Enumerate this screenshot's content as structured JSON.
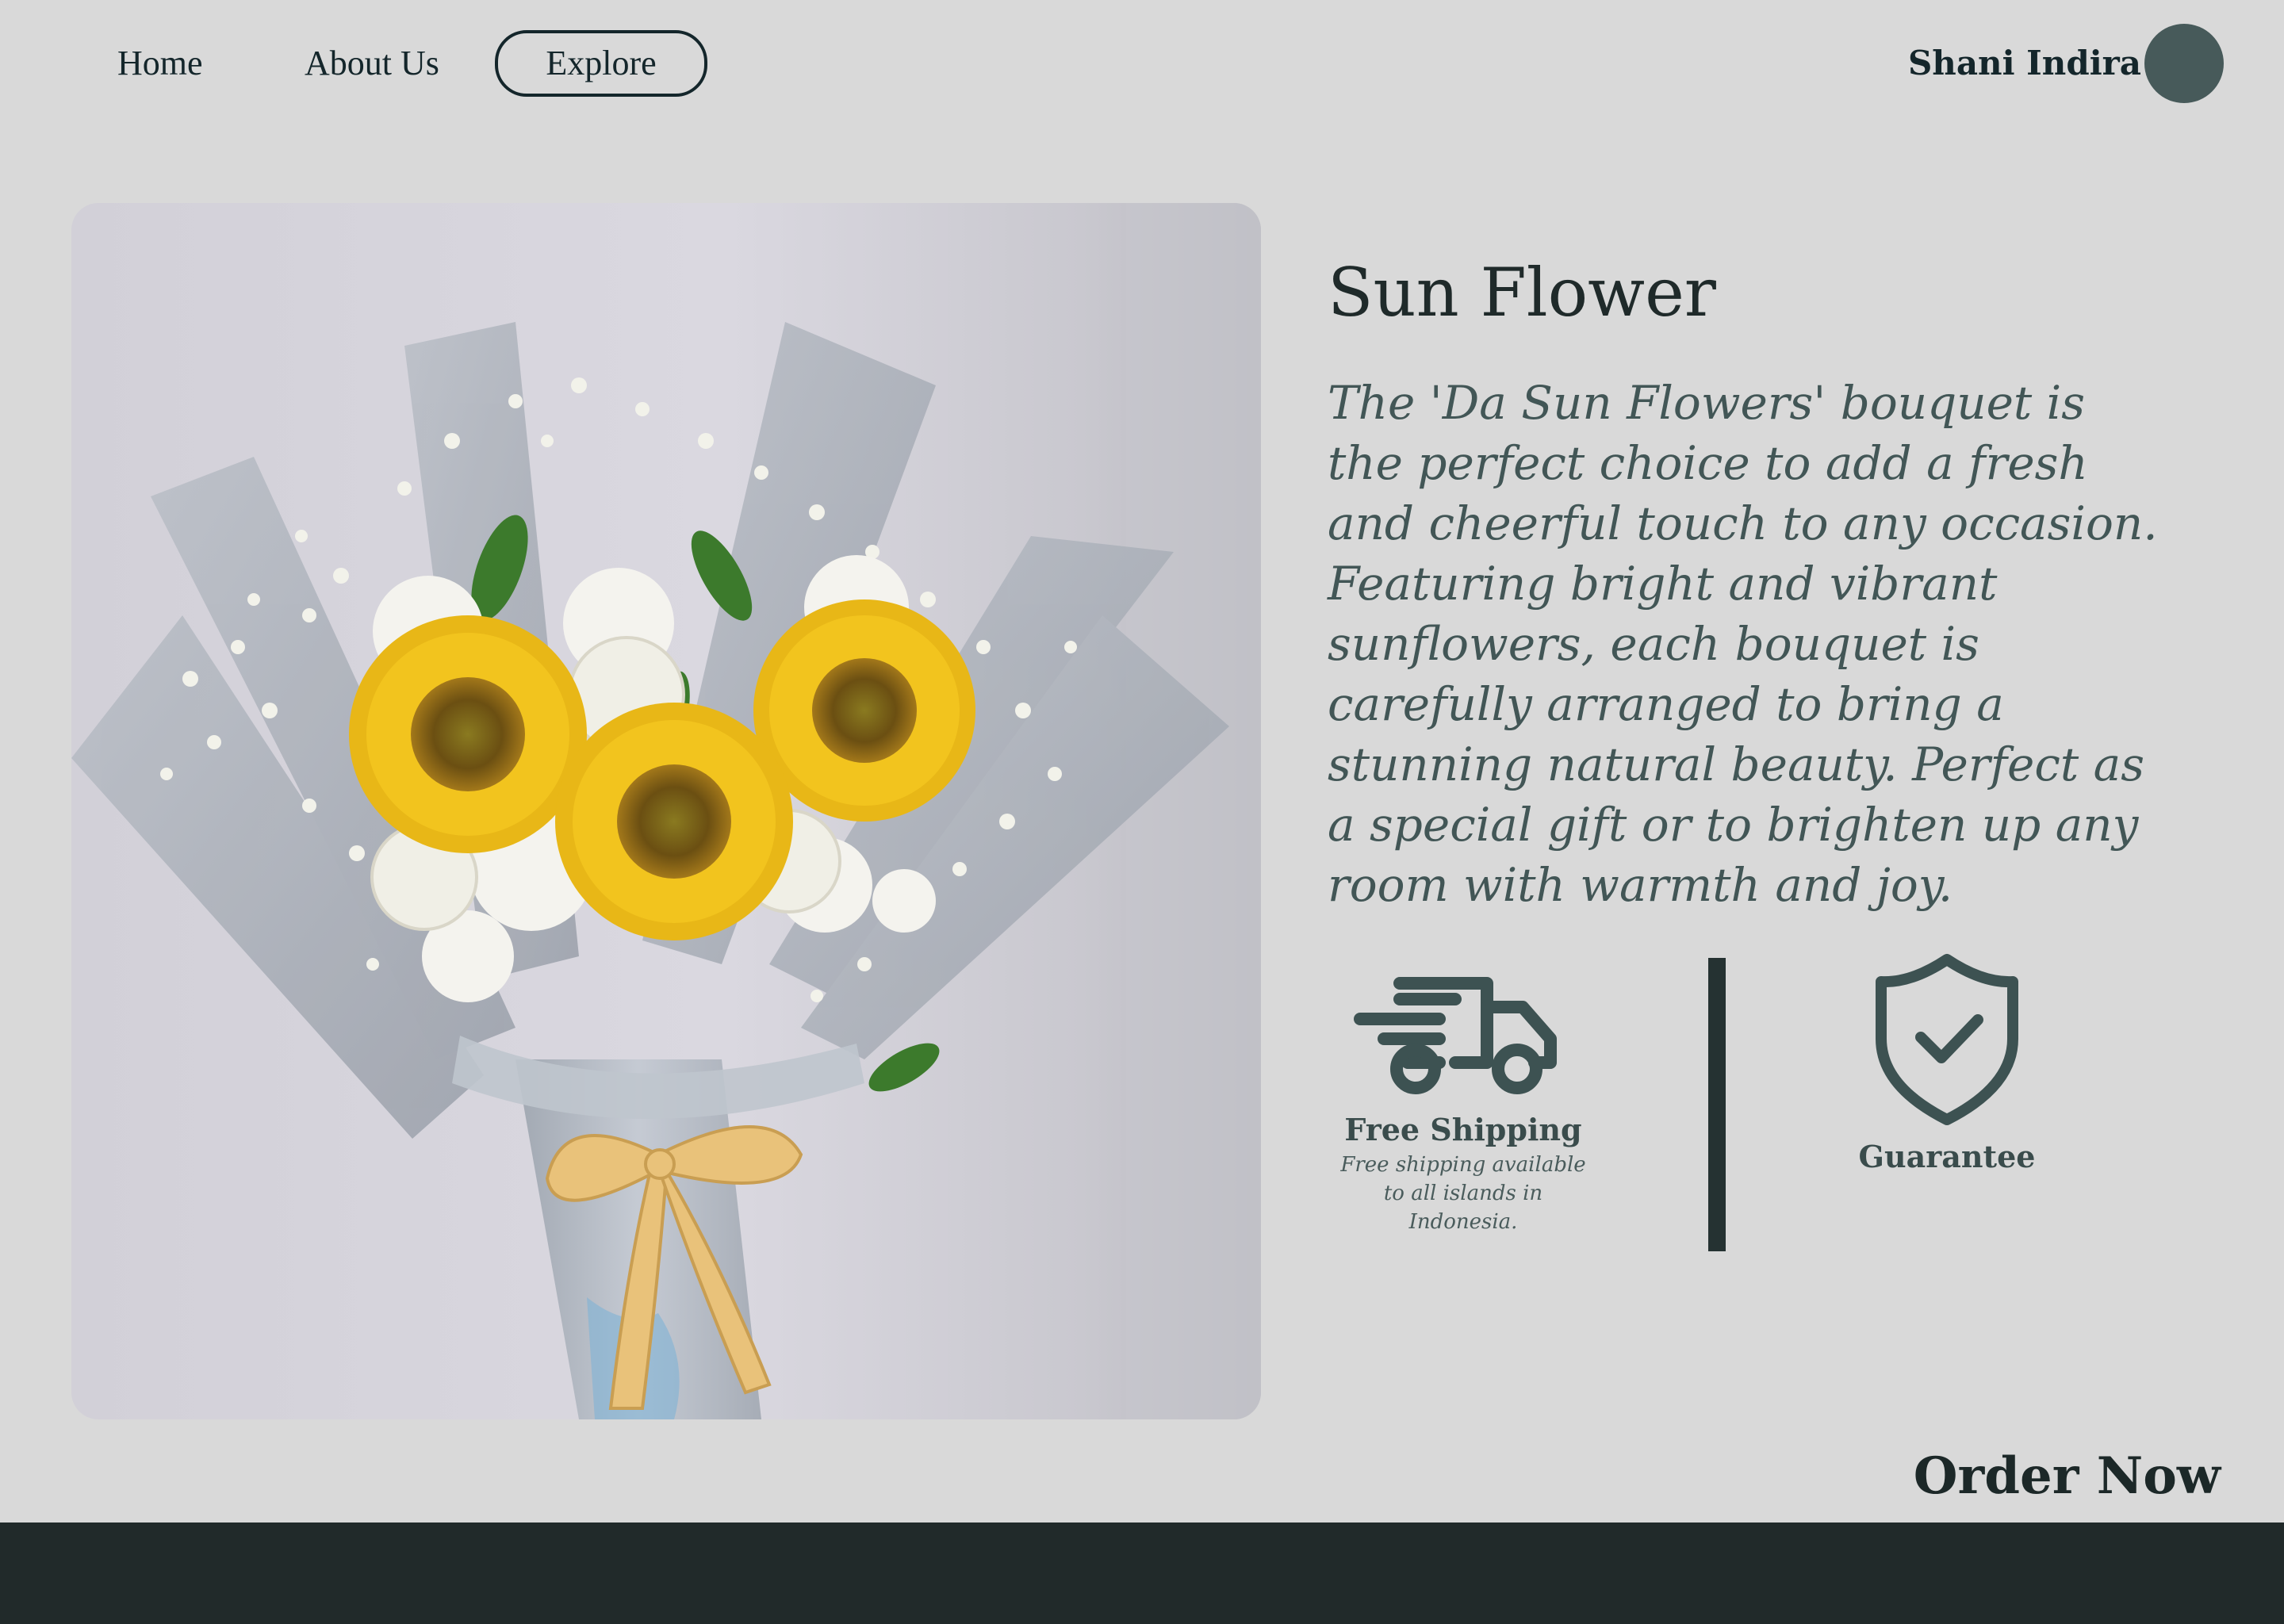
{
  "nav": {
    "home": "Home",
    "about": "About Us",
    "explore": "Explore",
    "user_name": "Shani Indira"
  },
  "product": {
    "title": "Sun Flower",
    "description": "The 'Da Sun Flowers' bouquet is the perfect choice to add a fresh and cheerful touch to any occasion. Featuring bright and vibrant sunflowers, each bouquet is carefully arranged to bring a stunning natural beauty. Perfect as a special gift or to brighten up any room with warmth and joy."
  },
  "features": {
    "shipping_title": "Free Shipping",
    "shipping_text": "Free shipping available to all islands in Indonesia.",
    "guarantee_title": "Guarantee"
  },
  "order_label": "Order Now",
  "colors": {
    "background": "#d9d9d9",
    "accent": "#3d5252",
    "footer": "#212a2a"
  },
  "icons": {
    "shipping": "delivery-truck-icon",
    "guarantee": "shield-check-icon"
  }
}
